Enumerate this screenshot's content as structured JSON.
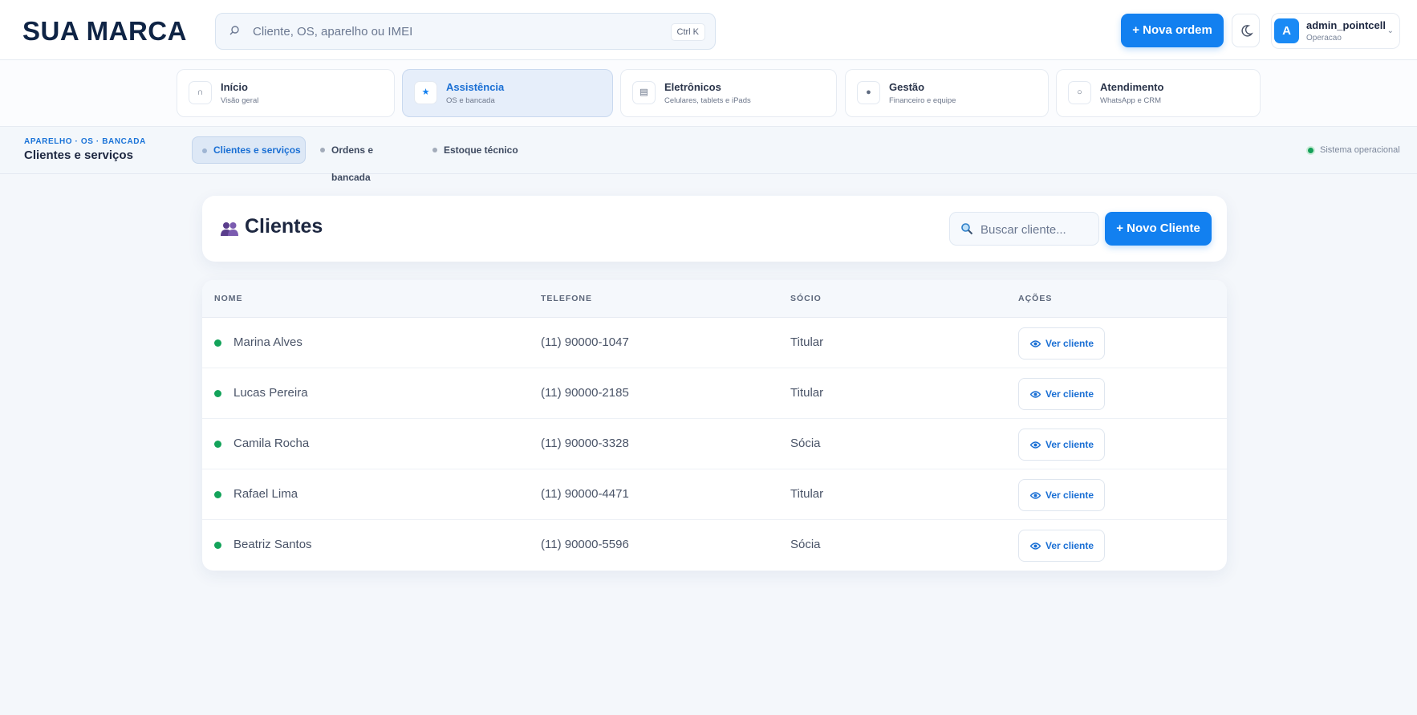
{
  "header": {
    "brand": "SUA MARCA",
    "search_placeholder": "Cliente, OS, aparelho ou IMEI",
    "search_shortcut": "Ctrl K",
    "new_order_label": "+ Nova ordem",
    "user_name": "admin_pointcell",
    "user_role": "Operacao",
    "user_initial": "A"
  },
  "modules": [
    {
      "title": "Início",
      "subtitle": "Visão geral",
      "icon": "home-icon"
    },
    {
      "title": "Assistência",
      "subtitle": "OS e bancada",
      "icon": "star-icon"
    },
    {
      "title": "Eletrônicos",
      "subtitle": "Celulares, tablets e iPads",
      "icon": "device-icon"
    },
    {
      "title": "Gestão",
      "subtitle": "Financeiro e equipe",
      "icon": "info-icon"
    },
    {
      "title": "Atendimento",
      "subtitle": "WhatsApp e CRM",
      "icon": "chat-icon"
    }
  ],
  "subnav": {
    "breadcrumb": "APARELHO · OS · BANCADA",
    "title": "Clientes e serviços",
    "tabs": [
      "Clientes e serviços",
      "Ordens e bancada",
      "Estoque técnico"
    ],
    "status": "Sistema operacional"
  },
  "clients": {
    "title": "Clientes",
    "search_placeholder": "Buscar cliente...",
    "new_label": "+ Novo Cliente",
    "columns": [
      "NOME",
      "TELEFONE",
      "SÓCIO",
      "AÇÕES"
    ],
    "action_label": "Ver cliente",
    "rows": [
      {
        "name": "Marina Alves",
        "phone": "(11) 90000-1047",
        "partner": "Titular"
      },
      {
        "name": "Lucas Pereira",
        "phone": "(11) 90000-2185",
        "partner": "Titular"
      },
      {
        "name": "Camila Rocha",
        "phone": "(11) 90000-3328",
        "partner": "Sócia"
      },
      {
        "name": "Rafael Lima",
        "phone": "(11) 90000-4471",
        "partner": "Titular"
      },
      {
        "name": "Beatriz Santos",
        "phone": "(11) 90000-5596",
        "partner": "Sócia"
      }
    ]
  },
  "colors": {
    "accent": "#1280f0",
    "status_ok": "#14a05a",
    "brand": "#0f2445"
  }
}
